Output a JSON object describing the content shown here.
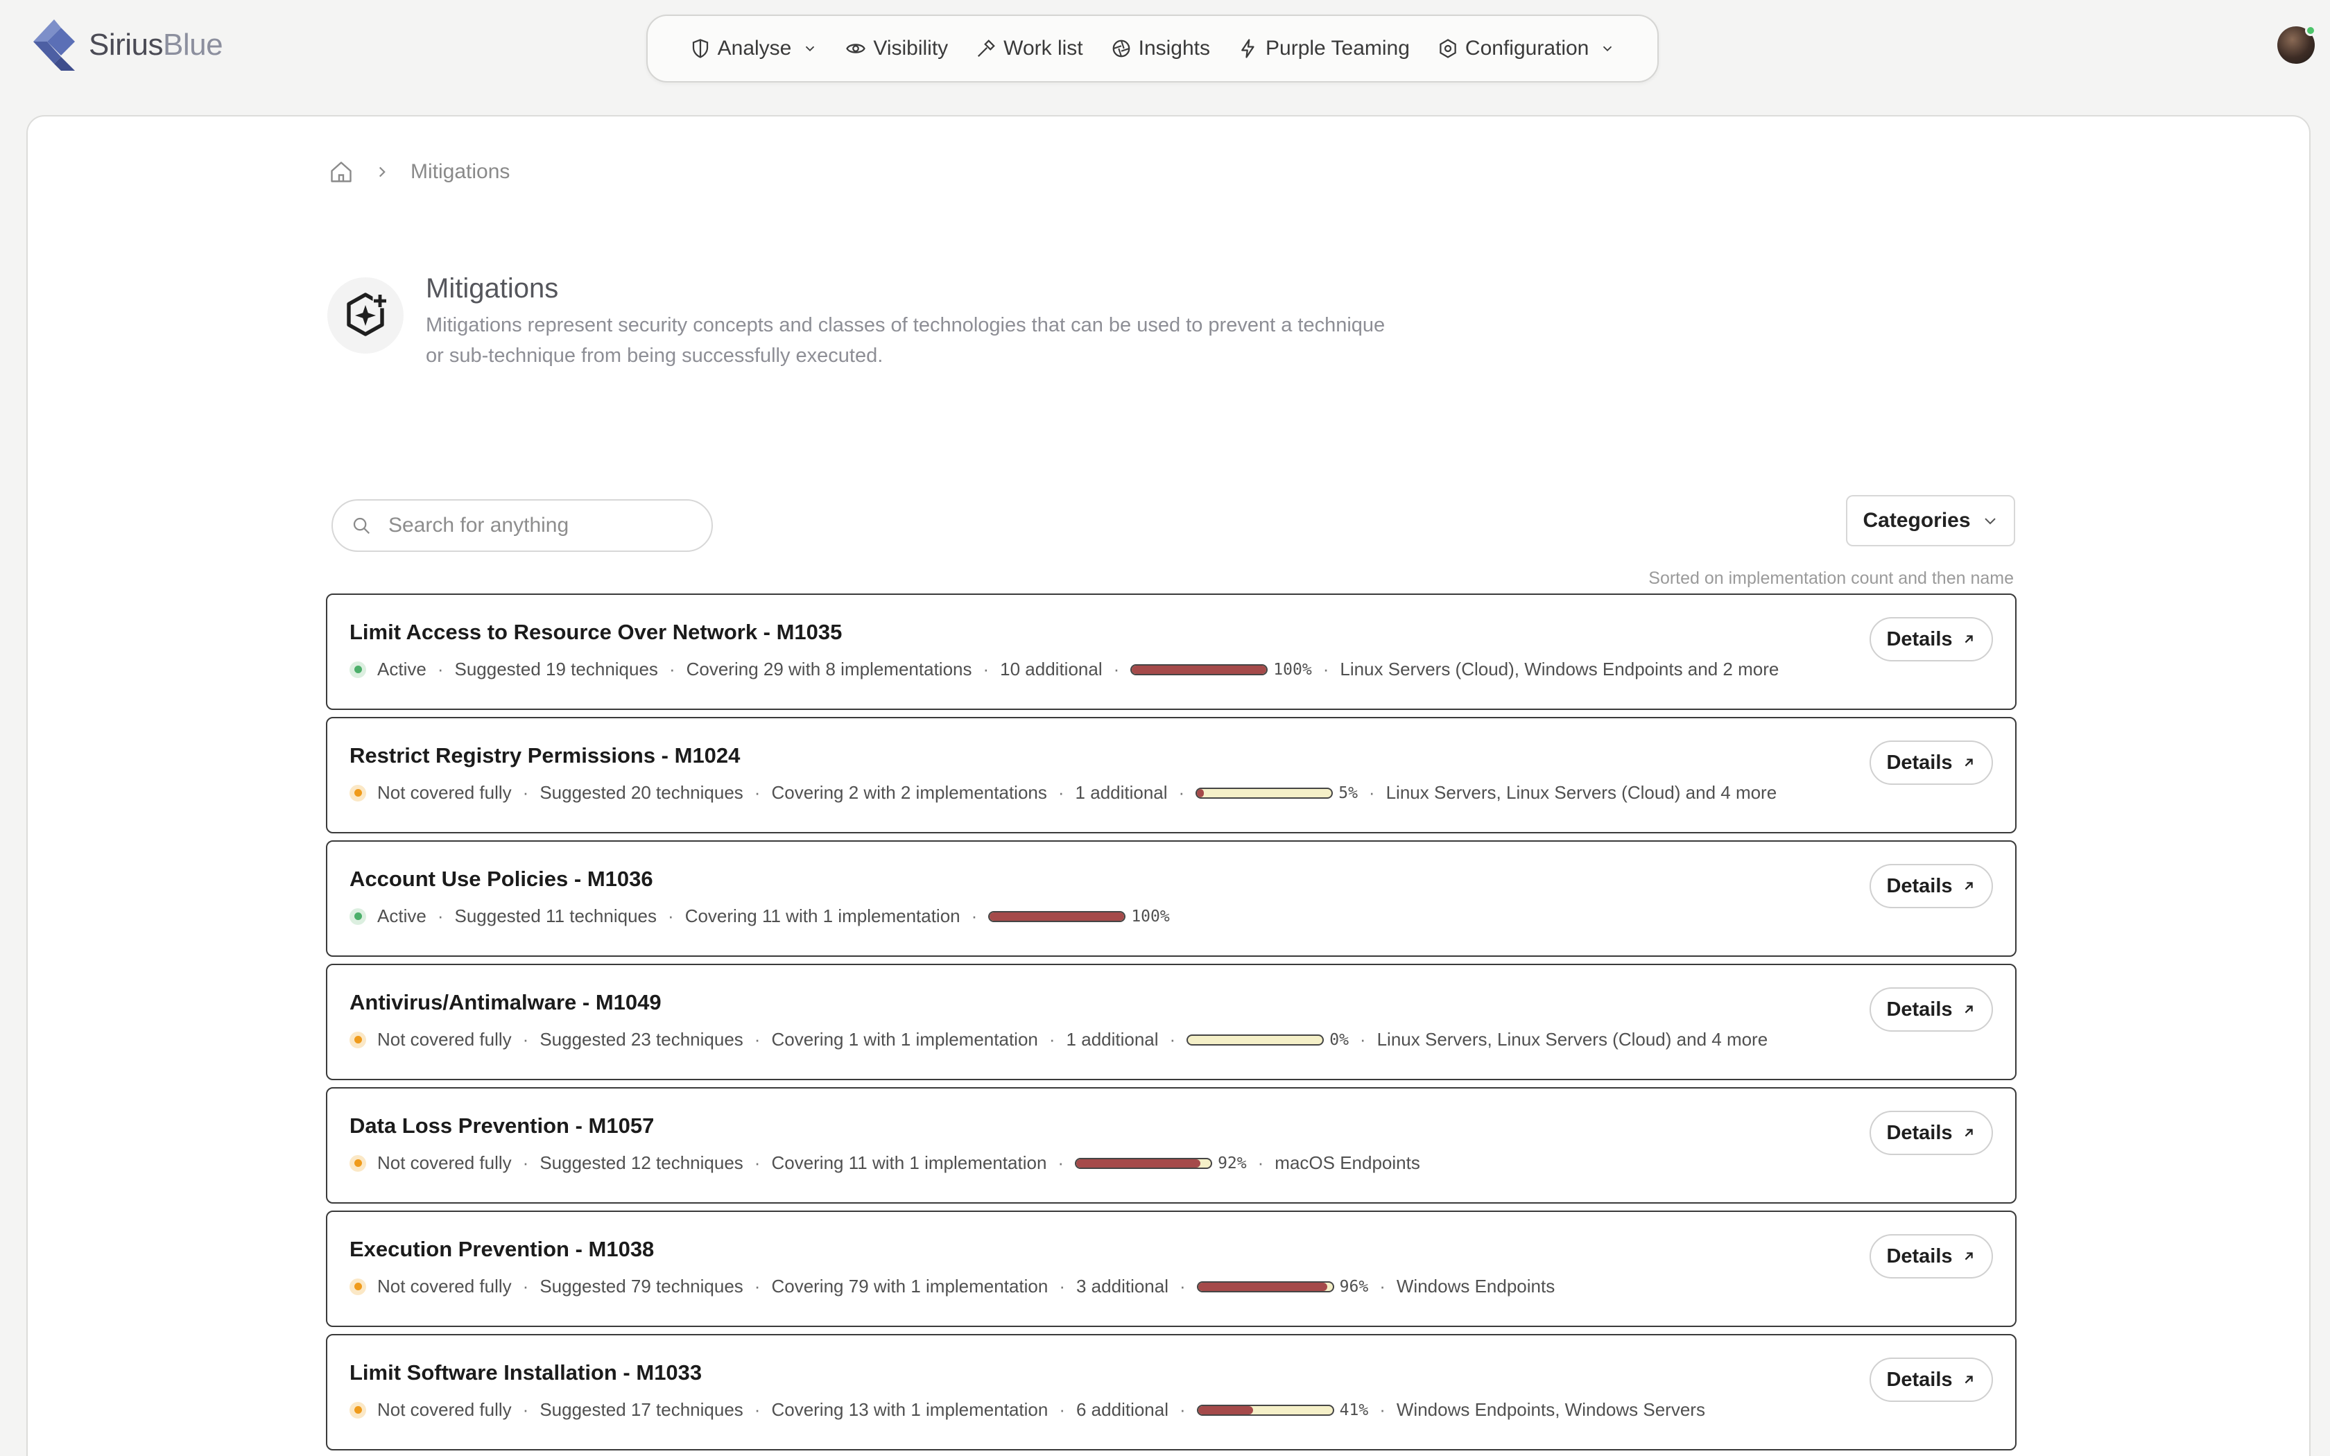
{
  "brand": {
    "name_part1": "Sirius",
    "name_part2": "Blue",
    "logo_icon": "siriusblue-logo-icon"
  },
  "nav": [
    {
      "label": "Analyse",
      "icon": "shield-half-icon",
      "dropdown": true
    },
    {
      "label": "Visibility",
      "icon": "eye-icon",
      "dropdown": false
    },
    {
      "label": "Work list",
      "icon": "hammer-icon",
      "dropdown": false
    },
    {
      "label": "Insights",
      "icon": "aperture-icon",
      "dropdown": false
    },
    {
      "label": "Purple Teaming",
      "icon": "lightning-icon",
      "dropdown": false
    },
    {
      "label": "Configuration",
      "icon": "hexagon-gear-icon",
      "dropdown": true
    }
  ],
  "breadcrumb": {
    "home_icon": "home-icon",
    "current": "Mitigations"
  },
  "page": {
    "title": "Mitigations",
    "description": "Mitigations represent security concepts and classes of technologies that can be used to prevent a technique or sub-technique from being successfully executed.",
    "icon": "hexagon-sparkle-icon"
  },
  "search": {
    "placeholder": "Search for anything",
    "value": ""
  },
  "categories_label": "Categories",
  "sort_note": "Sorted on implementation count and then name",
  "details_label": "Details",
  "colors": {
    "bar_fill": "#a54a4a",
    "bar_empty": "#f5f0c8",
    "active": "#4caf6a",
    "warning": "#ef9b1c"
  },
  "mitigations": [
    {
      "title": "Limit Access to Resource Over Network - M1035",
      "status": "Active",
      "status_kind": "active",
      "suggested": "Suggested 19 techniques",
      "covering": "Covering 29 with 8 implementations",
      "additional": "10 additional",
      "progress": 1.0,
      "percent": "100%",
      "platforms": "Linux Servers (Cloud), Windows Endpoints and 2 more"
    },
    {
      "title": "Restrict Registry Permissions - M1024",
      "status": "Not covered fully",
      "status_kind": "warn",
      "suggested": "Suggested 20 techniques",
      "covering": "Covering 2 with 2 implementations",
      "additional": "1 additional",
      "progress": 0.05,
      "percent": "5%",
      "platforms": "Linux Servers, Linux Servers (Cloud) and 4 more"
    },
    {
      "title": "Account Use Policies - M1036",
      "status": "Active",
      "status_kind": "active",
      "suggested": "Suggested 11 techniques",
      "covering": "Covering 11 with 1 implementation",
      "additional": "",
      "progress": 1.0,
      "percent": "100%",
      "platforms": ""
    },
    {
      "title": "Antivirus/Antimalware - M1049",
      "status": "Not covered fully",
      "status_kind": "warn",
      "suggested": "Suggested 23 techniques",
      "covering": "Covering 1 with 1 implementation",
      "additional": "1 additional",
      "progress": 0.0,
      "percent": "0%",
      "platforms": "Linux Servers, Linux Servers (Cloud) and 4 more"
    },
    {
      "title": "Data Loss Prevention - M1057",
      "status": "Not covered fully",
      "status_kind": "warn",
      "suggested": "Suggested 12 techniques",
      "covering": "Covering 11 with 1 implementation",
      "additional": "",
      "progress": 0.92,
      "percent": "92%",
      "platforms": "macOS Endpoints"
    },
    {
      "title": "Execution Prevention - M1038",
      "status": "Not covered fully",
      "status_kind": "warn",
      "suggested": "Suggested 79 techniques",
      "covering": "Covering 79 with 1 implementation",
      "additional": "3 additional",
      "progress": 0.96,
      "percent": "96%",
      "platforms": "Windows Endpoints"
    },
    {
      "title": "Limit Software Installation - M1033",
      "status": "Not covered fully",
      "status_kind": "warn",
      "suggested": "Suggested 17 techniques",
      "covering": "Covering 13 with 1 implementation",
      "additional": "6 additional",
      "progress": 0.41,
      "percent": "41%",
      "platforms": "Windows Endpoints, Windows Servers"
    }
  ]
}
